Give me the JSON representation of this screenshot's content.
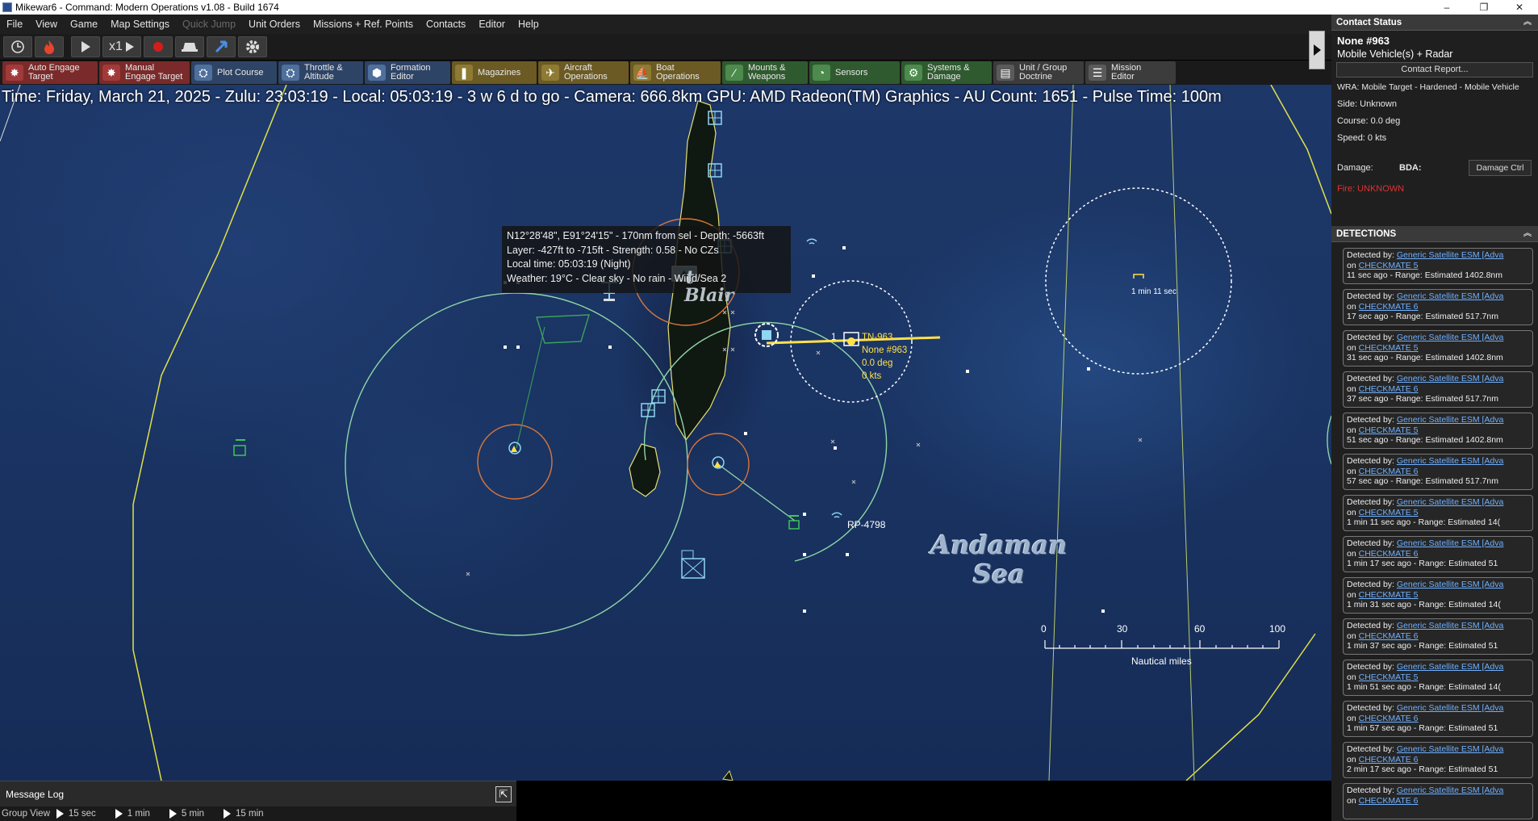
{
  "window": {
    "title": "Mikewar6 - Command: Modern Operations v1.08 - Build 1674",
    "minimize": "–",
    "maximize": "❐",
    "close": "✕"
  },
  "menu": [
    "File",
    "View",
    "Game",
    "Map Settings",
    "Quick Jump",
    "Unit Orders",
    "Missions + Ref. Points",
    "Contacts",
    "Editor",
    "Help"
  ],
  "toolbar": {
    "speed_label": "x1",
    "buttons": [
      {
        "id": "clock",
        "icon": "clock-icon"
      },
      {
        "id": "fire",
        "icon": "flame-icon"
      },
      {
        "id": "play",
        "icon": "play-icon"
      },
      {
        "id": "speed",
        "icon": "speed-icon"
      },
      {
        "id": "record",
        "icon": "record-icon"
      },
      {
        "id": "view",
        "icon": "hat-icon"
      },
      {
        "id": "pointer",
        "icon": "cursor-icon"
      },
      {
        "id": "settings",
        "icon": "gear-icon"
      }
    ]
  },
  "actions": [
    {
      "label": "Auto Engage\nTarget",
      "color": "red",
      "icon": "✸"
    },
    {
      "label": "Manual\nEngage Target",
      "color": "red",
      "icon": "✸"
    },
    {
      "label": "Plot Course",
      "color": "blue",
      "icon": "⛭"
    },
    {
      "label": "Throttle &\nAltitude",
      "color": "blue",
      "icon": "⛭"
    },
    {
      "label": "Formation\nEditor",
      "color": "blue",
      "icon": "⬢"
    },
    {
      "label": "Magazines",
      "color": "gold",
      "icon": "❚"
    },
    {
      "label": "Aircraft\nOperations",
      "color": "gold",
      "icon": "✈"
    },
    {
      "label": "Boat\nOperations",
      "color": "gold",
      "icon": "⛵"
    },
    {
      "label": "Mounts &\nWeapons",
      "color": "green",
      "icon": "⁄"
    },
    {
      "label": "Sensors",
      "color": "green",
      "icon": "◔"
    },
    {
      "label": "Systems &\nDamage",
      "color": "green",
      "icon": "⚙"
    },
    {
      "label": "Unit / Group\nDoctrine",
      "color": "gray",
      "icon": "▤"
    },
    {
      "label": "Mission\nEditor",
      "color": "gray",
      "icon": "☰"
    }
  ],
  "infobar": "Time: Friday, March 21, 2025 - Zulu: 23:03:19 - Local: 05:03:19 - 3 w 6 d to go - Camera: 666.8km GPU: AMD Radeon(TM) Graphics - AU Count: 1651 - Pulse Time: 100m",
  "tooltip": {
    "line1": "N12°28'48\", E91°24'15\" - 170nm from sel - Depth: -5663ft",
    "line2": "Layer: -427ft to -715ft - Strength: 0.58 - No CZs",
    "line3": "Local time: 05:03:19 (Night)",
    "line4": "Weather: 19°C - Clear sky - No rain - Wind/Sea 2"
  },
  "map_labels": {
    "sea_line1": "Andaman",
    "sea_line2": "Sea",
    "port_blair_1": "t",
    "port_blair_2": "Blair",
    "ref_point": "RP-4798",
    "timer": "1 min 11 sec",
    "contact_index": "1",
    "contact_tn": "TN-963",
    "contact_name": "None #963",
    "contact_course": "0.0 deg",
    "contact_speed": "0 kts"
  },
  "scale": {
    "ticks": [
      "0",
      "30",
      "60",
      "100"
    ],
    "unit": "Nautical miles"
  },
  "message_log": {
    "label": "Message Log",
    "popout": "⇱"
  },
  "group_view": {
    "label": "Group View",
    "items": [
      "15 sec",
      "1 min",
      "5 min",
      "15 min"
    ]
  },
  "contact_status": {
    "header": "Contact Status",
    "name": "None #963",
    "type": "Mobile Vehicle(s) + Radar",
    "report_button": "Contact Report...",
    "wra": "WRA: Mobile Target - Hardened - Mobile Vehicle",
    "side": "Side: Unknown",
    "course": "Course: 0.0 deg",
    "speed": "Speed: 0 kts",
    "damage_label": "Damage:",
    "bda_label": "BDA:",
    "damage_button": "Damage Ctrl",
    "fire": "Fire: UNKNOWN"
  },
  "detections": {
    "header": "DETECTIONS",
    "items": [
      {
        "by": "Generic Satellite ESM [Adva",
        "on": "CHECKMATE 5",
        "time": "11 sec ago",
        "range": "- Range: Estimated 1402.8nm"
      },
      {
        "by": "Generic Satellite ESM [Adva",
        "on": "CHECKMATE 6",
        "time": "17 sec ago",
        "range": "- Range: Estimated 517.7nm"
      },
      {
        "by": "Generic Satellite ESM [Adva",
        "on": "CHECKMATE 5",
        "time": "31 sec ago",
        "range": "- Range: Estimated 1402.8nm"
      },
      {
        "by": "Generic Satellite ESM [Adva",
        "on": "CHECKMATE 6",
        "time": "37 sec ago",
        "range": "- Range: Estimated 517.7nm"
      },
      {
        "by": "Generic Satellite ESM [Adva",
        "on": "CHECKMATE 5",
        "time": "51 sec ago",
        "range": "- Range: Estimated 1402.8nm"
      },
      {
        "by": "Generic Satellite ESM [Adva",
        "on": "CHECKMATE 6",
        "time": "57 sec ago",
        "range": "- Range: Estimated 517.7nm"
      },
      {
        "by": "Generic Satellite ESM [Adva",
        "on": "CHECKMATE 5",
        "time": "1 min 11 sec ago",
        "range": "- Range: Estimated 14("
      },
      {
        "by": "Generic Satellite ESM [Adva",
        "on": "CHECKMATE 6",
        "time": "1 min 17 sec ago",
        "range": "- Range: Estimated 51"
      },
      {
        "by": "Generic Satellite ESM [Adva",
        "on": "CHECKMATE 5",
        "time": "1 min 31 sec ago",
        "range": "- Range: Estimated 14("
      },
      {
        "by": "Generic Satellite ESM [Adva",
        "on": "CHECKMATE 6",
        "time": "1 min 37 sec ago",
        "range": "- Range: Estimated 51"
      },
      {
        "by": "Generic Satellite ESM [Adva",
        "on": "CHECKMATE 5",
        "time": "1 min 51 sec ago",
        "range": "- Range: Estimated 14("
      },
      {
        "by": "Generic Satellite ESM [Adva",
        "on": "CHECKMATE 6",
        "time": "1 min 57 sec ago",
        "range": "- Range: Estimated 51"
      },
      {
        "by": "Generic Satellite ESM [Adva",
        "on": "CHECKMATE 6",
        "time": "2 min 17 sec ago",
        "range": "- Range: Estimated 51"
      },
      {
        "by": "Generic Satellite ESM [Adva",
        "on": "CHECKMATE 6",
        "time": "",
        "range": ""
      }
    ],
    "detected_by_label": "Detected by:",
    "on_label": "on"
  },
  "colors": {
    "yellow": "#ffe14a",
    "range_ring_green": "#8fd6a8",
    "range_ring_orange": "#d9773a",
    "link": "#6fb0ff"
  }
}
